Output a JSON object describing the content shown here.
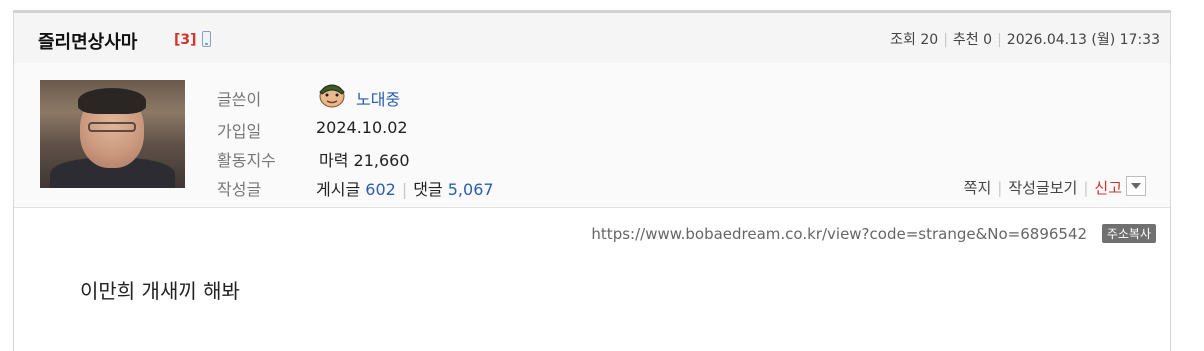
{
  "post": {
    "title": "즐리면상사마",
    "comment_count": "[3]",
    "meta": {
      "views_label": "조회",
      "views": "20",
      "recommend_label": "추천",
      "recommend": "0",
      "datetime": "2026.04.13 (월) 17:33"
    }
  },
  "author": {
    "labels": {
      "writer": "글쓴이",
      "joined": "가입일",
      "activity": "활동지수",
      "posts": "작성글"
    },
    "nickname": "노대중",
    "joined": "2024.10.02",
    "activity_label": "마력",
    "activity_value": "21,660",
    "posts_label": "게시글",
    "posts_count": "602",
    "comments_label": "댓글",
    "comments_count": "5,067"
  },
  "actions": {
    "message": "쪽지",
    "view_posts": "작성글보기",
    "report": "신고"
  },
  "url": {
    "text": "https://www.bobaedream.co.kr/view?code=strange&No=6896542",
    "copy_label": "주소복사"
  },
  "content": {
    "text": "이만희 개새끼 해봐"
  },
  "icons": {
    "mobile": "mobile-phone-icon",
    "user_level": "user-level-icon",
    "dropdown": "chevron-down-icon"
  }
}
